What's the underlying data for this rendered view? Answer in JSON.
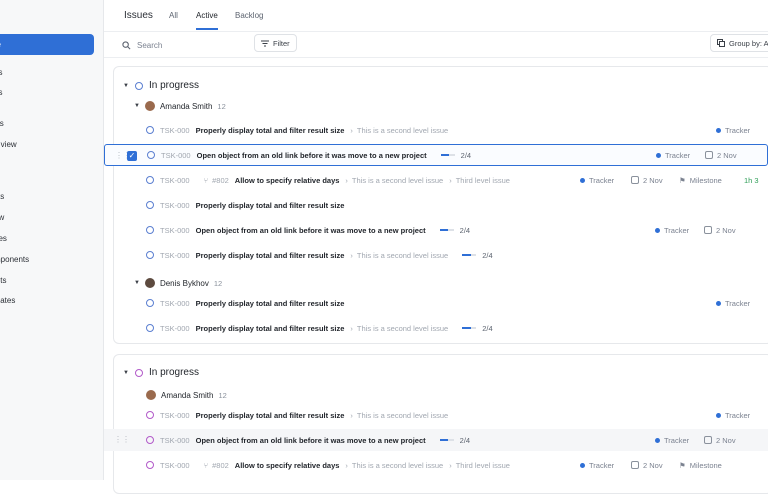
{
  "sidebar": {
    "new_label": "ue",
    "items": [
      "es",
      "es",
      "ws",
      "e view",
      "w",
      "cts",
      "ow",
      "ues",
      "mponents",
      "ints",
      "plates"
    ]
  },
  "header": {
    "title": "Issues",
    "tabs": [
      "All",
      "Active",
      "Backlog"
    ],
    "active_tab": "Active"
  },
  "toolbar": {
    "search_placeholder": "Search",
    "filter_label": "Filter",
    "group_label": "Group by: A"
  },
  "groups": [
    {
      "title": "In progress",
      "users": [
        {
          "name": "Amanda Smith",
          "count": "12"
        },
        {
          "name": "Denis Bykhov",
          "count": "12"
        }
      ],
      "rows": [
        {
          "id": "TSK-000",
          "title": "Properly display total and filter result size",
          "sub": "This is a second level issue",
          "tracker": "Tracker"
        },
        {
          "id": "TSK-000",
          "title": "Open object from an old link before it was move to a new project",
          "progress": "2/4",
          "tracker": "Tracker",
          "date": "2 Nov"
        },
        {
          "id": "TSK-000",
          "subid": "#802",
          "title": "Allow to specify relative days",
          "sub": "This is a second level issue",
          "sub2": "Third level issue",
          "tracker": "Tracker",
          "date": "2 Nov",
          "milestone": "Milestone",
          "time": "1h 3"
        },
        {
          "id": "TSK-000",
          "title": "Properly display total and filter result size"
        },
        {
          "id": "TSK-000",
          "title": "Open object from an old link before it was move to a new project",
          "progress": "2/4",
          "tracker": "Tracker",
          "date": "2 Nov"
        },
        {
          "id": "TSK-000",
          "title": "Properly display total and filter result size",
          "sub": "This is a second level issue",
          "progress": "2/4"
        },
        {
          "id": "TSK-000",
          "title": "Properly display total and filter result size",
          "tracker": "Tracker"
        },
        {
          "id": "TSK-000",
          "title": "Properly display total and filter result size",
          "sub": "This is a second level issue",
          "progress": "2/4"
        }
      ]
    },
    {
      "title": "In progress",
      "users": [
        {
          "name": "Amanda Smith",
          "count": "12"
        }
      ],
      "rows": [
        {
          "id": "TSK-000",
          "title": "Properly display total and filter result size",
          "sub": "This is a second level issue",
          "tracker": "Tracker"
        },
        {
          "id": "TSK-000",
          "title": "Open object from an old link before it was move to a new project",
          "progress": "2/4",
          "tracker": "Tracker",
          "date": "2 Nov"
        },
        {
          "id": "TSK-000",
          "subid": "#802",
          "title": "Allow to specify relative days",
          "sub": "This is a second level issue",
          "sub2": "Third level issue",
          "tracker": "Tracker",
          "date": "2 Nov",
          "milestone": "Milestone"
        }
      ]
    }
  ],
  "colors": {
    "accent": "#2f6fd6",
    "purple_status": "#b25ac9",
    "time_green": "#2f9e58"
  }
}
